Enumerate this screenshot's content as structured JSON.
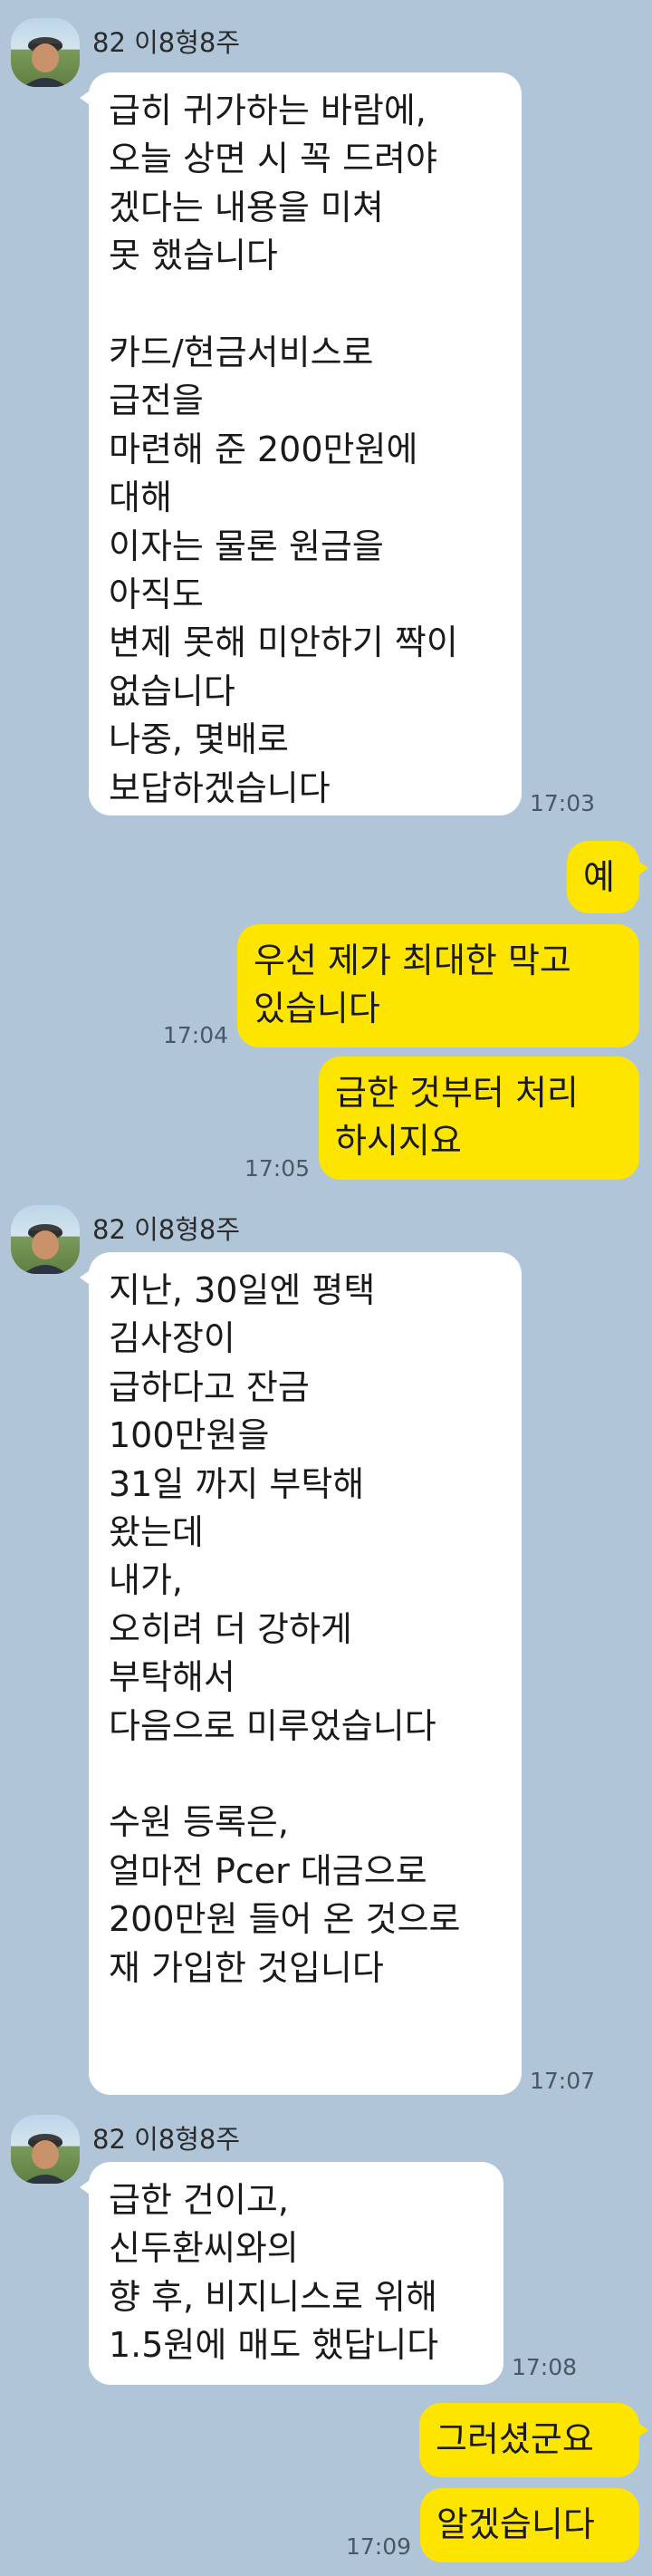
{
  "messages": [
    {
      "sender": "82 이8형8주",
      "text": "급히 귀가하는 바람에,\n오늘 상면 시 꼭 드려야\n겠다는 내용을 미쳐\n못 했습니다\n\n카드/현금서비스로\n급전을\n마련해 준 200만원에\n대해\n이자는 물론 원금을\n아직도\n변제 못해 미안하기 짝이\n없습니다\n나중, 몇배로\n보답하겠습니다",
      "time": "17:03"
    },
    {
      "text": "예"
    },
    {
      "text": "우선 제가 최대한 막고\n있습니다",
      "time": "17:04"
    },
    {
      "text": "급한 것부터 처리\n하시지요",
      "time": "17:05"
    },
    {
      "sender": "82 이8형8주",
      "text": "지난, 30일엔 평택\n김사장이\n급하다고 잔금\n100만원을\n31일 까지 부탁해\n왔는데\n내가,\n오히려 더 강하게\n부탁해서\n다음으로 미루었습니다\n\n수원 등록은,\n얼마전 Pcer 대금으로\n200만원 들어 온 것으로\n재 가입한 것입니다\n\n",
      "time": "17:07"
    },
    {
      "sender": "82 이8형8주",
      "text": "급한 건이고,\n신두환씨와의\n향 후, 비지니스로 위해\n1.5원에 매도 했답니다",
      "time": "17:08"
    },
    {
      "text": "그러셨군요"
    },
    {
      "text": "알겠습니다",
      "time": "17:09"
    }
  ],
  "colors": {
    "background": "#b0c5d8",
    "incoming_bubble": "#ffffff",
    "outgoing_bubble": "#fee500"
  }
}
